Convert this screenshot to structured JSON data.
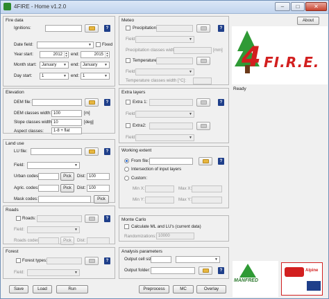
{
  "window": {
    "title": "4FIRE - Home v1.2.0",
    "minimize": "–",
    "maximize": "□",
    "close": "✕"
  },
  "fire_data": {
    "title": "Fire data",
    "ignitions_label": "Ignitions: ",
    "date_field_label": "Date field:",
    "fixed_label": "Fixed",
    "year_start_label": "Year start:",
    "year_start_value": "2012",
    "end_label": "end:",
    "year_end_value": "2015",
    "month_start_label": "Month start:",
    "month_start_value": "January",
    "month_end_label": "end:",
    "month_end_value": "January",
    "day_start_label": "Day start:",
    "day_start_value": "1",
    "day_end_label": "end:",
    "day_end_value": "1"
  },
  "meteo": {
    "title": "Meteo",
    "precipitation_label": "Precipitation",
    "field_label": "Field:",
    "precip_classes_label": "Precipitation classes width:",
    "precip_unit": "[mm]",
    "temperature_label": "Temperature",
    "field2_label": "Field:",
    "temp_classes_label": "Temperature classes width [°C]:"
  },
  "elevation": {
    "title": "Elevation",
    "dem_file_label": "DEM file:",
    "dem_classes_label": "DEM classes width:",
    "dem_classes_value": "100",
    "dem_unit": "[m]",
    "slope_classes_label": "Slope classes width:",
    "slope_classes_value": "10",
    "slope_unit": "[deg]",
    "aspect_classes_label": "Aspect classes:",
    "aspect_classes_value": "1-8 + flat"
  },
  "extra_layers": {
    "title": "Extra layers",
    "extra1_label": "Extra 1:",
    "field1_label": "Field:",
    "extra2_label": "Extra2:",
    "field2_label": "Field:"
  },
  "land_use": {
    "title": "Land use",
    "lu_file_label": "LU file:",
    "field_label": "Field:",
    "urban_codes_label": "Urban codes:",
    "pick_label": "Pick",
    "dist_label": "Dist:",
    "urban_dist_value": "100",
    "agri_codes_label": "Agric. codes:",
    "agri_dist_value": "100",
    "mask_codes_label": "Mask codes:",
    "pick2_label": "Pick"
  },
  "working_extent": {
    "title": "Working extent",
    "from_file_label": "From file:",
    "intersection_label": "Intersection of input layers",
    "custom_label": "Custom:",
    "min_x_label": "Min X:",
    "max_x_label": "Max X:",
    "min_y_label": "Min Y:",
    "max_y_label": "Max Y:"
  },
  "roads": {
    "title": "Roads",
    "roads_label": "Roads:",
    "field_label": "Field:",
    "roads_codes_label": "Roads codes:",
    "pick_label": "Pick",
    "dist_label": "Dist:"
  },
  "monte_carlo": {
    "title": "Monte Carlo",
    "calc_label": "Calculate ML and LU's (current data)",
    "randomizations_label": "Randomizations:",
    "randomizations_value": "10000"
  },
  "forest": {
    "title": "Forest",
    "forest_types_label": "Forest types:",
    "field_label": "Field:"
  },
  "analysis": {
    "title": "Analysis parameters",
    "cell_size_label": "Output cell size:",
    "folder_label": "Output folder:"
  },
  "buttons": {
    "save": "Save",
    "load": "Load",
    "run": "Run",
    "preprocess": "Preprocess",
    "mc": "MC",
    "overlay": "Overlay",
    "about": "About"
  },
  "help_label": "?",
  "logo": {
    "number": "4",
    "text": "FI.R.E."
  },
  "status": "Ready",
  "partners": {
    "manfred": "MANFRED",
    "alpine": "Alpine"
  },
  "colors": {
    "accent_green": "#2f9a35",
    "accent_red": "#d21f1f",
    "help_blue": "#1f3f8a"
  }
}
